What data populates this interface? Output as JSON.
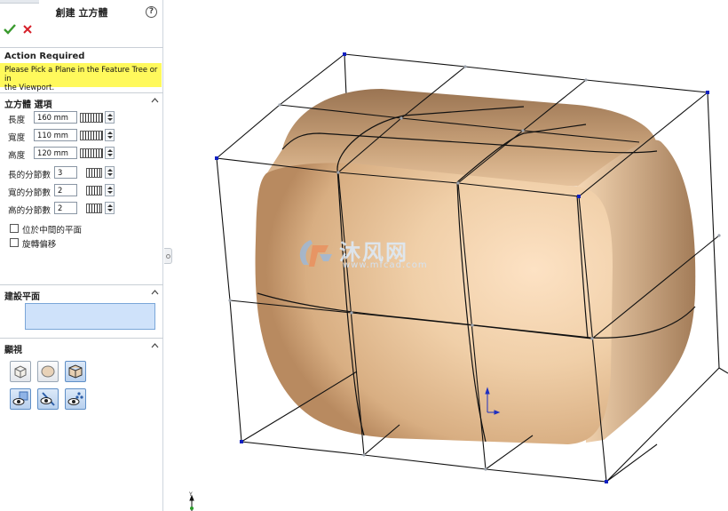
{
  "panel": {
    "title": "創建 立方體",
    "help_icon": "help-icon",
    "ok_icon": "checkmark-icon",
    "cancel_icon": "x-icon",
    "ok_color": "#3a9a2e",
    "cancel_color": "#d6202a"
  },
  "action_required": {
    "header": "Action Required",
    "message_line1": "Please Pick a Plane in the Feature Tree or in",
    "message_line2": "the Viewport.",
    "highlight_color": "#fff95c"
  },
  "options": {
    "header": "立方體 選項",
    "fields": [
      {
        "label": "長度",
        "value": "160 mm"
      },
      {
        "label": "寬度",
        "value": "110 mm"
      },
      {
        "label": "高度",
        "value": "120 mm"
      },
      {
        "label": "長的分節數",
        "value": "3"
      },
      {
        "label": "寬的分節數",
        "value": "2"
      },
      {
        "label": "高的分節數",
        "value": "2"
      }
    ],
    "checkboxes": [
      {
        "label": "位於中間的平面",
        "checked": false
      },
      {
        "label": "旋轉偏移",
        "checked": false
      }
    ]
  },
  "setup_plane": {
    "header": "建設平面",
    "field_value": ""
  },
  "display": {
    "header": "顯視",
    "buttons_row1": [
      "box-icon",
      "shaded-ellipse-icon",
      "cage-box-icon"
    ],
    "buttons_row2": [
      "eye-plane-icon",
      "eye-edge-icon",
      "eye-points-icon"
    ]
  },
  "viewport": {
    "watermark_text": "沐风网",
    "watermark_url": "www.mfcad.com",
    "axis_label": "Y",
    "surface_color": "#e8c29a",
    "cage_color": "#111111",
    "vertex_color": "#1020c0"
  }
}
